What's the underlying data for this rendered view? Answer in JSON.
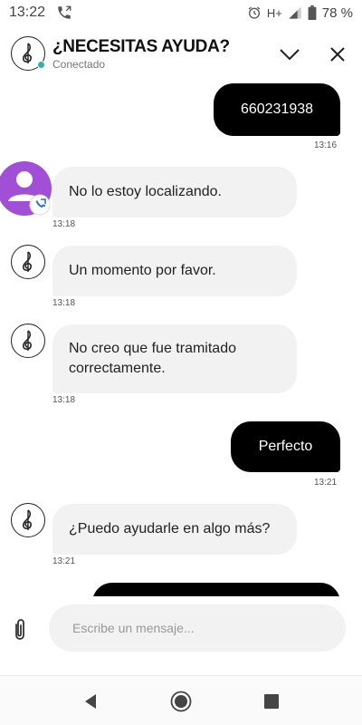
{
  "status_bar": {
    "time": "13:22",
    "network": "H+",
    "battery": "78 %"
  },
  "header": {
    "title": "¿NECESITAS AYUDA?",
    "status": "Conectado",
    "status_color": "#2fb1a6"
  },
  "messages": [
    {
      "sender": "user",
      "text": "660231938",
      "time": "13:16"
    },
    {
      "sender": "agent",
      "text": "No lo estoy localizando.",
      "time": "13:18"
    },
    {
      "sender": "agent",
      "text": "Un momento por favor.",
      "time": "13:18"
    },
    {
      "sender": "agent",
      "text": "No creo que fue tramitado correctamente.",
      "time": "13:18"
    },
    {
      "sender": "user",
      "text": "Perfecto",
      "time": "13:21"
    },
    {
      "sender": "agent",
      "text": "¿Puedo ayudarle en algo más?",
      "time": "13:21"
    }
  ],
  "composer": {
    "placeholder": "Escribe un mensaje..."
  },
  "icons": {
    "status_call": "phone-icon",
    "alarm": "alarm-icon",
    "signal": "signal-icon",
    "battery": "battery-icon",
    "collapse": "chevron-down-icon",
    "close": "close-icon",
    "attach": "paperclip-icon",
    "back": "back-icon",
    "home": "home-icon",
    "recents": "recents-icon"
  },
  "colors": {
    "user_bubble": "#000000",
    "agent_bubble": "#f2f2f2",
    "user_avatar": "#a04fd6"
  }
}
